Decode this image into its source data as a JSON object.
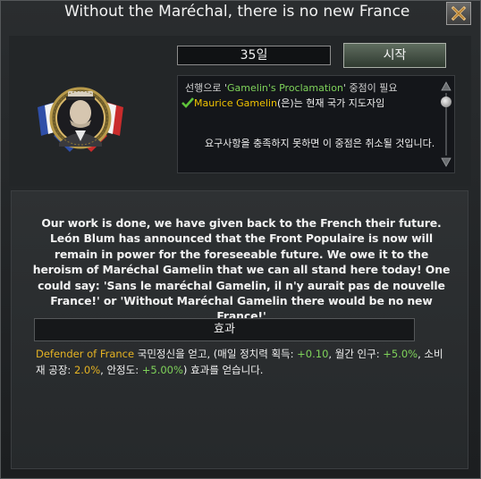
{
  "window": {
    "title": "Without the Maréchal, there is no new France"
  },
  "header": {
    "days_label": "35일",
    "start_label": "시작"
  },
  "requirements": {
    "line1_prefix": "선행으로 '",
    "line1_focus": "Gamelin's Proclamation",
    "line1_suffix": "' 중점이 필요",
    "line2_name": "Maurice Gamelin",
    "line2_suffix": "(은)는 현재 국가 지도자임",
    "line3": "요구사항을 충족하지 못하면 이 중점은 취소될 것입니다."
  },
  "description": {
    "text": "Our work is done, we have given back to the French their future. León Blum has announced that the Front Populaire is now will remain in power for the foreseeable future. We owe it to the heroism of Maréchal Gamelin that we can all stand here today! One could say: 'Sans le maréchal Gamelin, il n'y aurait pas de nouvelle France!' or 'Without Maréchal Gamelin there would be no new France!'"
  },
  "effects": {
    "header": "효과",
    "spirit_name": "Defender of France",
    "p1": " 국민정신을 얻고, (매일 정치력 획득: ",
    "v1": "+0.10",
    "p2": ", 월간 인구: ",
    "v2": "+5.0%",
    "p3": ", 소비재 공장: ",
    "v3": "2.0%",
    "p4": ", 안정도: ",
    "v4": "+5.00%",
    "p5": ") 효과를 얻습니다."
  },
  "colors": {
    "focus_green": "#7fd35a",
    "leader_yellow": "#f0c200",
    "spirit_gold": "#e5b323",
    "value_green": "#7fd35a"
  },
  "icons": {
    "close": "close-x-icon",
    "check": "checkmark-icon",
    "focus": "french-focus-emblem-icon",
    "scroll_up": "scroll-up-arrow-icon",
    "scroll_down": "scroll-down-arrow-icon"
  }
}
